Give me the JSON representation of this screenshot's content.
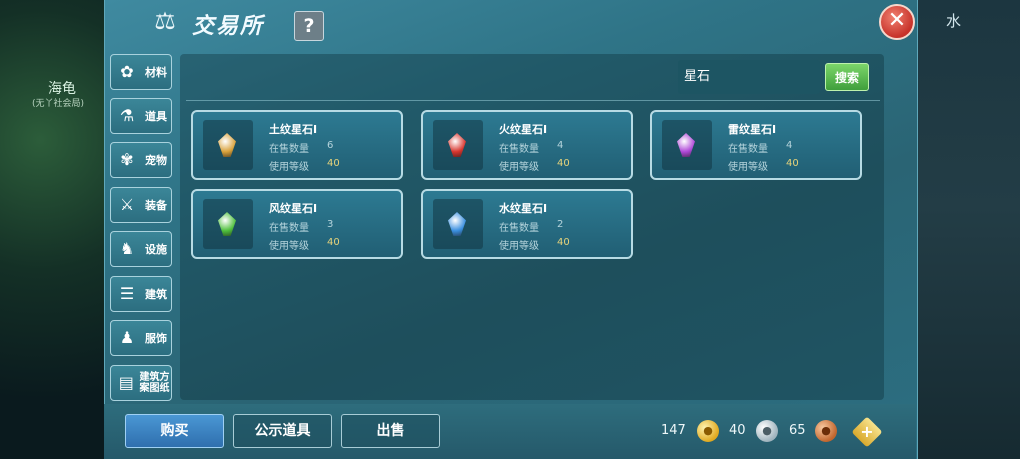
{
  "background": {
    "npc_name": "海龟",
    "npc_sub": "(无丫社会局)",
    "right_text": "水"
  },
  "header": {
    "title": "交易所",
    "help_label": "?",
    "close_label": "✕"
  },
  "categories": [
    {
      "label": "材料",
      "icon": "flower-icon"
    },
    {
      "label": "道具",
      "icon": "flask-icon"
    },
    {
      "label": "宠物",
      "icon": "paw-icon"
    },
    {
      "label": "装备",
      "icon": "sword-icon"
    },
    {
      "label": "设施",
      "icon": "horse-icon"
    },
    {
      "label": "建筑",
      "icon": "building-icon"
    },
    {
      "label": "服饰",
      "icon": "clothing-icon"
    },
    {
      "label": "建筑方案图纸",
      "icon": "blueprint-icon"
    }
  ],
  "search": {
    "value": "星石",
    "button_label": "搜索"
  },
  "items": [
    {
      "name": "土纹星石Ⅰ",
      "on_sale_label": "在售数量",
      "on_sale": "6",
      "level_label": "使用等级",
      "level": "40",
      "gem_color": "#d9a13a"
    },
    {
      "name": "火纹星石Ⅰ",
      "on_sale_label": "在售数量",
      "on_sale": "4",
      "level_label": "使用等级",
      "level": "40",
      "gem_color": "#d8352e"
    },
    {
      "name": "雷纹星石Ⅰ",
      "on_sale_label": "在售数量",
      "on_sale": "4",
      "level_label": "使用等级",
      "level": "40",
      "gem_color": "#b048d8"
    },
    {
      "name": "风纹星石Ⅰ",
      "on_sale_label": "在售数量",
      "on_sale": "3",
      "level_label": "使用等级",
      "level": "40",
      "gem_color": "#4fc03c"
    },
    {
      "name": "水纹星石Ⅰ",
      "on_sale_label": "在售数量",
      "on_sale": "2",
      "level_label": "使用等级",
      "level": "40",
      "gem_color": "#3a8fe0"
    }
  ],
  "bottom": {
    "buy_label": "购买",
    "showcase_label": "公示道具",
    "sell_label": "出售",
    "gold": "147",
    "silver": "40",
    "bronze": "65",
    "add_label": "+"
  }
}
